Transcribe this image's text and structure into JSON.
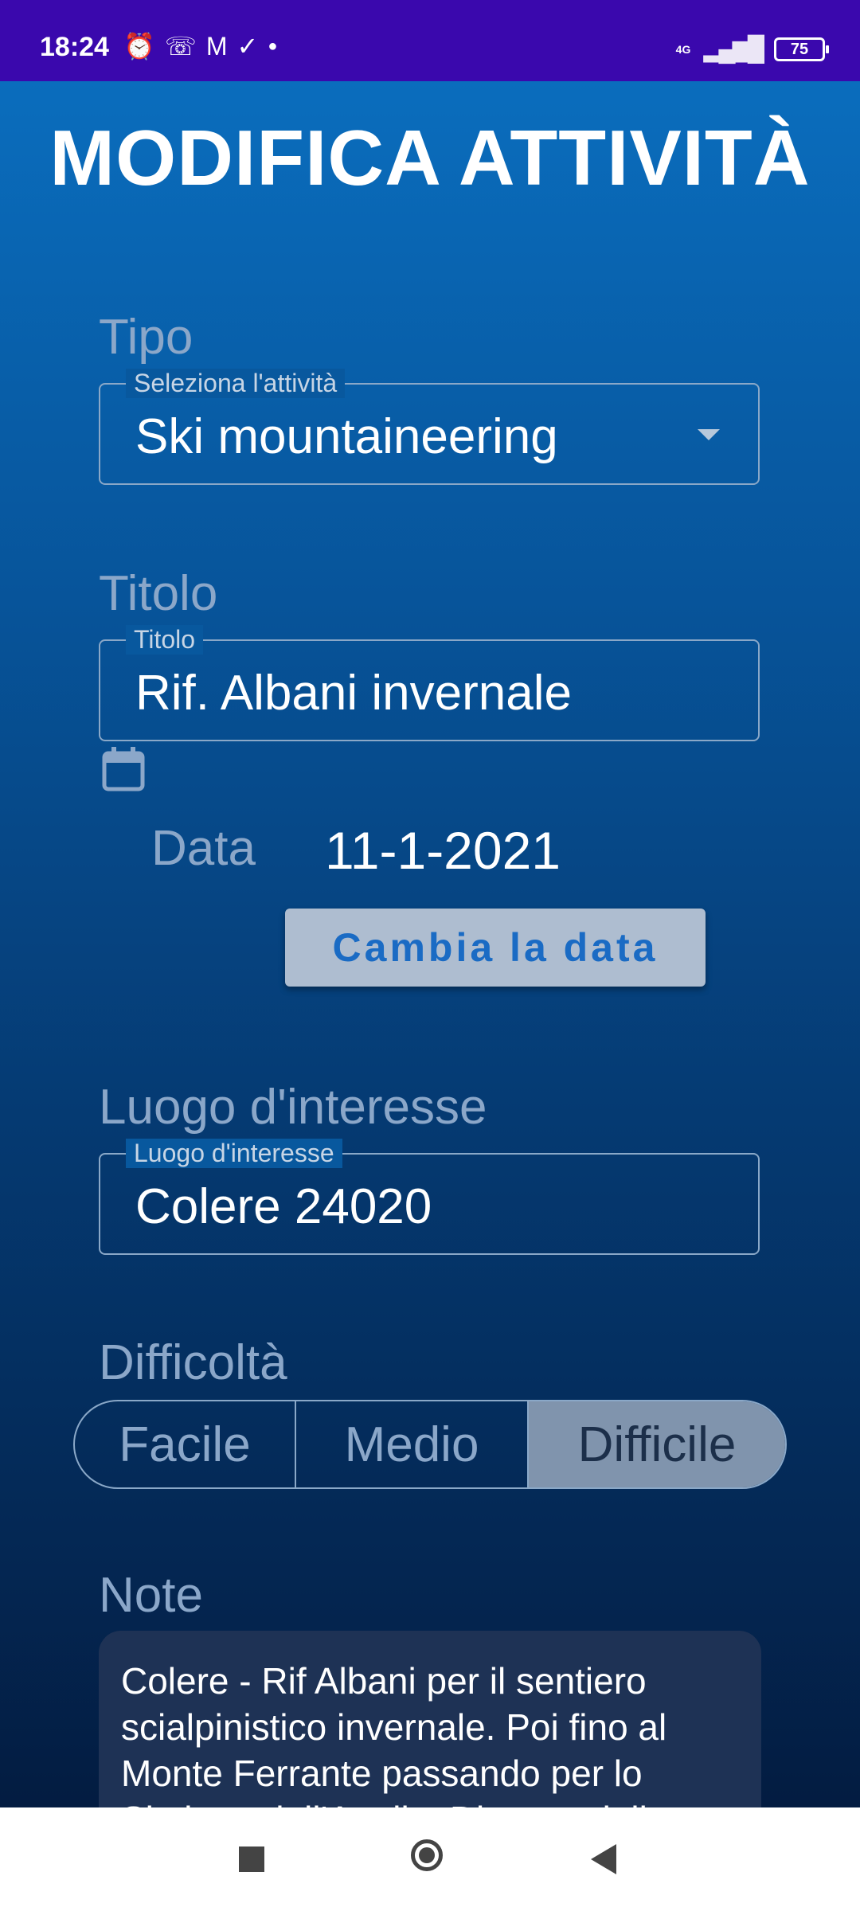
{
  "status_bar": {
    "time": "18:24",
    "network": "4G",
    "battery": "75",
    "icons": [
      "alarm-icon",
      "missed-call-icon",
      "gmail-icon",
      "task-check-icon",
      "dot-icon",
      "signal-icon",
      "battery-icon"
    ]
  },
  "page": {
    "title": "MODIFICA ATTIVITÀ"
  },
  "tipo": {
    "label": "Tipo",
    "field_label": "Seleziona l'attività",
    "value": "Ski mountaineering"
  },
  "titolo": {
    "label": "Titolo",
    "field_label": "Titolo",
    "value": "Rif. Albani invernale"
  },
  "data": {
    "label": "Data",
    "value": "11-1-2021",
    "button": "Cambia la data"
  },
  "luogo": {
    "label": "Luogo d'interesse",
    "field_label": "Luogo d'interesse",
    "value": "Colere 24020"
  },
  "difficolta": {
    "label": "Difficoltà",
    "options": [
      "Facile",
      "Medio",
      "Difficile"
    ],
    "selected": "Difficile"
  },
  "note": {
    "label": "Note",
    "text": "Colere - Rif Albani per il sentiero scialpinistico invernale. Poi fino al Monte Ferrante passando per lo Skalone dell'Angilo. Discesa dalla"
  },
  "colors": {
    "status_bar": "#3a08ad",
    "gradient_top": "#0a6dbd",
    "gradient_bottom": "#031c41",
    "button_text": "#1a6bc4",
    "selected_segment": "#8094ad"
  }
}
